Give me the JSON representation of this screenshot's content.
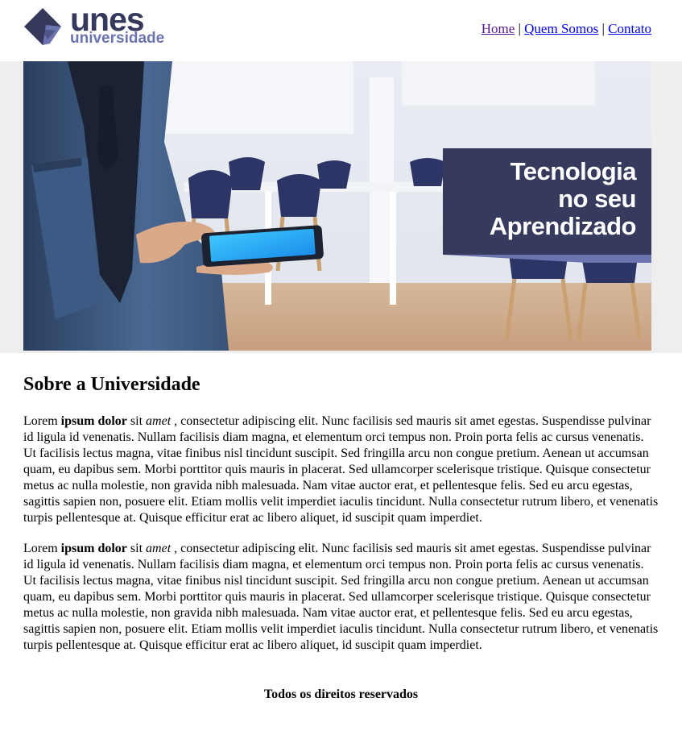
{
  "header": {
    "logo": {
      "wordmark": "unes",
      "subtitle": "universidade"
    },
    "nav": [
      {
        "label": "Home"
      },
      {
        "label": "Quem Somos"
      },
      {
        "label": "Contato"
      }
    ],
    "nav_separator": "|"
  },
  "banner": {
    "tagline_lines": [
      "Tecnologia",
      "no seu",
      "Aprendizado"
    ]
  },
  "main": {
    "title": "Sobre a Universidade",
    "paragraphs": [
      {
        "lead": "Lorem ",
        "bold": "ipsum dolor",
        "mid": " sit ",
        "italic": "amet",
        "rest": " , consectetur adipiscing elit. Nunc facilisis sed mauris sit amet egestas. Suspendisse pulvinar id ligula id venenatis. Nullam facilisis diam magna, et elementum orci tempus non. Proin porta felis ac cursus venenatis. Ut facilisis lectus magna, vitae finibus nisl tincidunt suscipit. Sed fringilla arcu non congue pretium. Aenean ut accumsan quam, eu dapibus sem. Morbi porttitor quis mauris in placerat. Sed ullamcorper scelerisque tristique. Quisque consectetur metus ac nulla molestie, non gravida nibh malesuada. Nam vitae auctor erat, et pellentesque felis. Sed eu arcu egestas, sagittis sapien non, posuere elit. Etiam mollis velit imperdiet iaculis tincidunt. Nulla consectetur rutrum libero, et venenatis turpis pellentesque at. Quisque efficitur erat ac libero aliquet, id suscipit quam imperdiet."
      },
      {
        "lead": "Lorem ",
        "bold": "ipsum dolor",
        "mid": " sit ",
        "italic": "amet",
        "rest": " , consectetur adipiscing elit. Nunc facilisis sed mauris sit amet egestas. Suspendisse pulvinar id ligula id venenatis. Nullam facilisis diam magna, et elementum orci tempus non. Proin porta felis ac cursus venenatis. Ut facilisis lectus magna, vitae finibus nisl tincidunt suscipit. Sed fringilla arcu non congue pretium. Aenean ut accumsan quam, eu dapibus sem. Morbi porttitor quis mauris in placerat. Sed ullamcorper scelerisque tristique. Quisque consectetur metus ac nulla molestie, non gravida nibh malesuada. Nam vitae auctor erat, et pellentesque felis. Sed eu arcu egestas, sagittis sapien non, posuere elit. Etiam mollis velit imperdiet iaculis tincidunt. Nulla consectetur rutrum libero, et venenatis turpis pellentesque at. Quisque efficitur erat ac libero aliquet, id suscipit quam imperdiet."
      }
    ]
  },
  "footer": {
    "text": "Todos os direitos reservados"
  },
  "colors": {
    "brand_dark": "#353a5d",
    "brand_light": "#6b74ae",
    "link": "#0000ee",
    "link_visited": "#551a8b"
  }
}
